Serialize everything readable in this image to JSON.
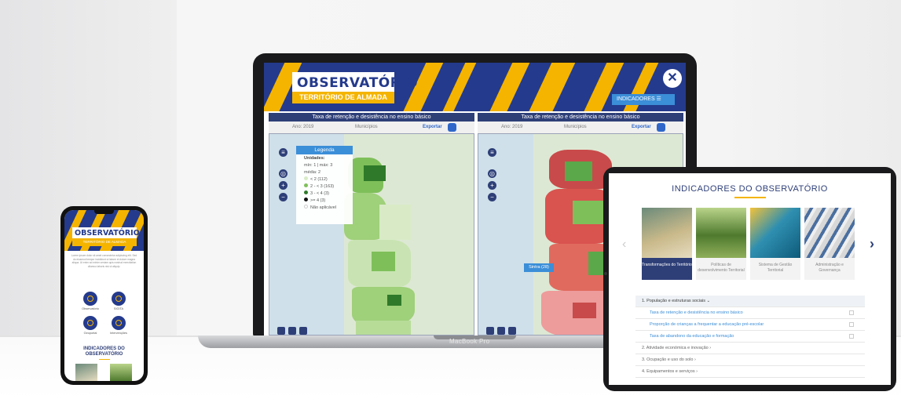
{
  "laptop": {
    "brand": "OBSERVATÓRIO",
    "subtitle": "TERRITÓRIO DE ALMADA",
    "close_label": "✕",
    "indicators_button": "INDICADORES ☰",
    "device_label": "MacBook Pro",
    "left_panel": {
      "title": "Taxa de retenção e desistência no ensino básico",
      "year": "Ano: 2019",
      "scope": "Municípios",
      "export": "Exportar",
      "legend": {
        "title": "Legenda",
        "units": "Unidades:",
        "minmax": "mín: 1 | máx: 3",
        "media": "média: 2",
        "rows": [
          "< 2 (112)",
          "2 - < 3 (163)",
          "3 - < 4 (3)",
          ">= 4 (3)",
          "Não aplicável"
        ]
      }
    },
    "right_panel": {
      "title": "Taxa de retenção e desistência no ensino básico",
      "year": "Ano: 2019",
      "scope": "Municípios",
      "export": "Exportar",
      "marker": "Sintra (28)"
    }
  },
  "tablet": {
    "title": "INDICADORES DO OBSERVATÓRIO",
    "cards": [
      {
        "label": "Transformações do Território"
      },
      {
        "label": "Políticas de desenvolvimento Territorial"
      },
      {
        "label": "Sistema de Gestão Territorial"
      },
      {
        "label": "Administração e Governança"
      }
    ],
    "accordion": [
      {
        "label": "1.  População e estruturas sociais  ⌄",
        "type": "head"
      },
      {
        "label": "Taxa de retenção e desistência no ensino básico",
        "type": "sub"
      },
      {
        "label": "Proporção de crianças a frequentar a educação pré-escolar",
        "type": "sub"
      },
      {
        "label": "Taxa de abandono da educação e formação",
        "type": "sub"
      },
      {
        "label": "2.  Atividade económica e inovação  ›",
        "type": "item"
      },
      {
        "label": "3.  Ocupação e uso do solo  ›",
        "type": "item"
      },
      {
        "label": "4.  Equipamentos e serviços  ›",
        "type": "item"
      }
    ]
  },
  "phone": {
    "brand": "OBSERVATÓRIO",
    "subtitle": "TERRITÓRIO DE ALMADA",
    "intro": "Lorem ipsum dolor sit amet consectetur adipiscing elit. Sed do eiusmod tempor incididunt ut labore et dolore magna aliqua. Ut enim ad minim veniam quis nostrud exercitation ullamco laboris nisi ut aliquip.",
    "icons": [
      {
        "label": "Observatório"
      },
      {
        "label": "SIGITA"
      },
      {
        "label": "Geoportal"
      },
      {
        "label": "Intervenções"
      }
    ],
    "section_title": "INDICADORES DO OBSERVATÓRIO"
  }
}
